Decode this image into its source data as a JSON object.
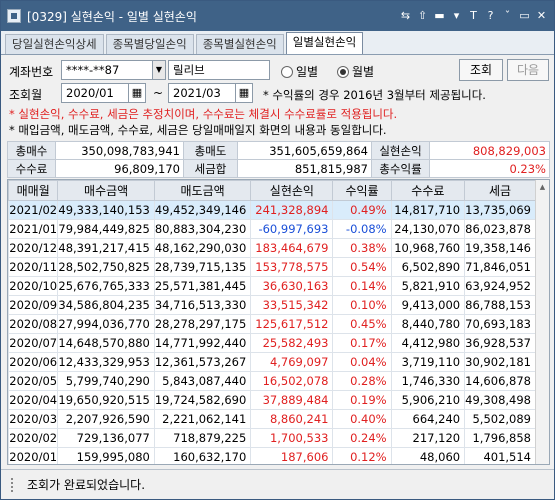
{
  "window": {
    "title": "[0329] 실현손익 - 일별 실현손익"
  },
  "titlebar_icons": [
    "window-icon",
    "swap-icon",
    "pin-icon",
    "minus-underline-icon",
    "flag-icon",
    "text-icon",
    "help-icon",
    "minimize-icon",
    "maximize-icon",
    "close-icon"
  ],
  "titlebar_glyphs": [
    "⇆",
    "⇧",
    "▬",
    "▾",
    "T",
    "?",
    "ˇ",
    "▭",
    "✕"
  ],
  "tabs": [
    "당일실현손익상세",
    "종목별당일손익",
    "종목별실현손익",
    "일별실현손익"
  ],
  "active_tab": 3,
  "form": {
    "account_label": "계좌번호",
    "account_value": "****-**87",
    "account_name": "릴리브",
    "period_label": "조회월",
    "from_month": "2020/01",
    "tilde": "~",
    "to_month": "2021/03",
    "mode_daily": "일별",
    "mode_monthly": "월별",
    "mode_selected": "월별",
    "query_btn": "조회",
    "next_btn": "다음",
    "note_top": "* 수익률의 경우 2016년 3월부터 제공됩니다.",
    "note_red": "* 실현손익, 수수료, 세금은 추정치이며, 수수료는 체결시 수수료률로 적용됩니다.",
    "note_black": "* 매입금액, 매도금액, 수수료, 세금은 당일매매일지 화면의 내용과 동일합니다."
  },
  "summary": {
    "total_buy_label": "총매수",
    "total_buy": "350,098,783,941",
    "total_sell_label": "총매도",
    "total_sell": "351,605,659,864",
    "realized_label": "실현손익",
    "realized": "808,829,003",
    "fee_label": "수수료",
    "fee": "96,809,170",
    "tax_label": "세금합",
    "tax": "851,815,987",
    "return_label": "총수익률",
    "return": "0.23%"
  },
  "grid": {
    "headers": [
      "매매월",
      "매수금액",
      "매도금액",
      "실현손익",
      "수익률",
      "수수료",
      "세금"
    ],
    "rows": [
      [
        "2021/02",
        "49,333,140,153",
        "49,452,349,146",
        "241,328,894",
        "0.49%",
        "14,817,710",
        "13,735,069"
      ],
      [
        "2021/01",
        "79,984,449,825",
        "80,883,304,230",
        "-60,997,693",
        "-0.08%",
        "24,130,070",
        "86,023,878"
      ],
      [
        "2020/12",
        "48,391,217,415",
        "48,162,290,030",
        "183,464,679",
        "0.38%",
        "10,968,760",
        "19,358,146"
      ],
      [
        "2020/11",
        "28,502,750,825",
        "28,739,715,135",
        "153,778,575",
        "0.54%",
        "6,502,890",
        "71,846,051"
      ],
      [
        "2020/10",
        "25,676,765,333",
        "25,571,381,445",
        "36,630,163",
        "0.14%",
        "5,821,910",
        "63,924,952"
      ],
      [
        "2020/09",
        "34,586,804,235",
        "34,716,513,330",
        "33,515,342",
        "0.10%",
        "9,413,000",
        "86,788,153"
      ],
      [
        "2020/08",
        "27,994,036,770",
        "28,278,297,175",
        "125,617,512",
        "0.45%",
        "8,440,780",
        "70,693,183"
      ],
      [
        "2020/07",
        "14,648,570,880",
        "14,771,992,440",
        "25,582,493",
        "0.17%",
        "4,412,980",
        "36,928,537"
      ],
      [
        "2020/06",
        "12,433,329,953",
        "12,361,573,267",
        "4,769,097",
        "0.04%",
        "3,719,110",
        "30,902,181"
      ],
      [
        "2020/05",
        "5,799,740,290",
        "5,843,087,440",
        "16,502,078",
        "0.28%",
        "1,746,330",
        "14,606,878"
      ],
      [
        "2020/04",
        "19,650,920,515",
        "19,724,582,690",
        "37,889,484",
        "0.19%",
        "5,906,210",
        "49,308,498"
      ],
      [
        "2020/03",
        "2,207,926,590",
        "2,221,062,141",
        "8,860,241",
        "0.40%",
        "664,240",
        "5,502,089"
      ],
      [
        "2020/02",
        "729,136,077",
        "718,879,225",
        "1,700,533",
        "0.24%",
        "217,120",
        "1,796,858"
      ],
      [
        "2020/01",
        "159,995,080",
        "160,632,170",
        "187,606",
        "0.12%",
        "48,060",
        "401,514"
      ]
    ]
  },
  "status": {
    "message": "조회가 완료되었습니다."
  }
}
